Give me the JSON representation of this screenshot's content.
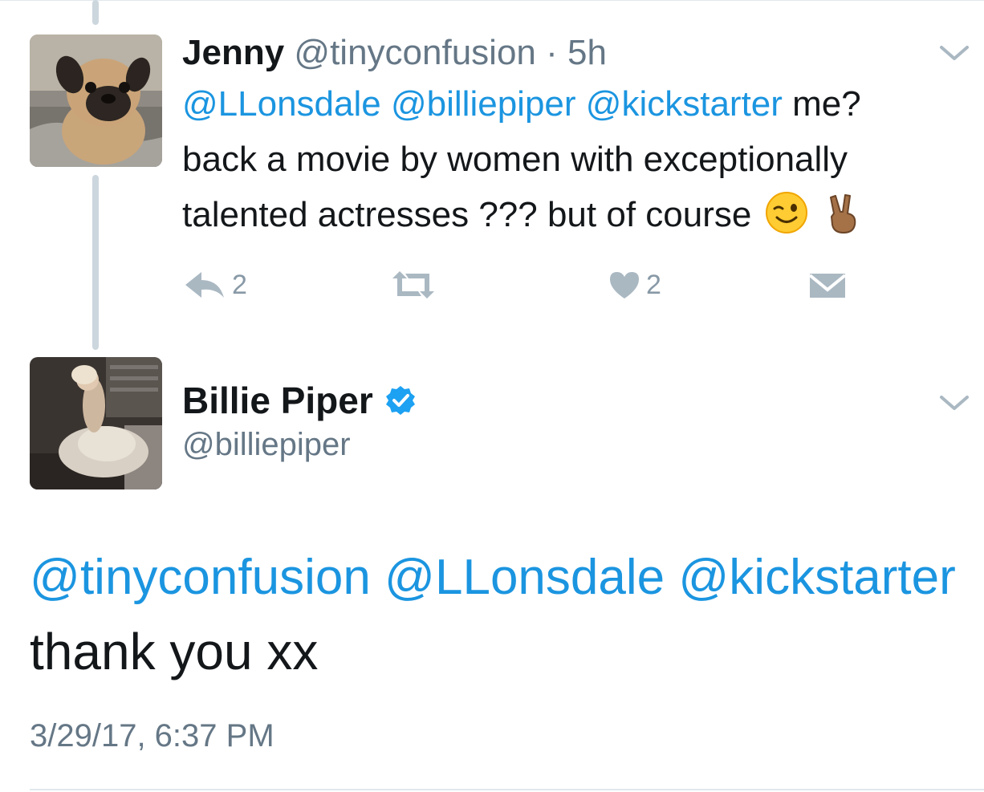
{
  "parent_tweet": {
    "author_name": "Jenny",
    "author_handle": "@tinyconfusion",
    "separator": "·",
    "time_ago": "5h",
    "mentions": [
      "@LLonsdale",
      "@billiepiper",
      "@kickstarter"
    ],
    "text_after_mentions": "me?",
    "text_line2": "back a movie by women with exceptionally",
    "text_line3": "talented actresses ??? but of course",
    "emojis": [
      "winking-face-emoji",
      "victory-hand-emoji"
    ],
    "reply_count": "2",
    "like_count": "2",
    "icons": {
      "reply": "reply-icon",
      "retweet": "retweet-icon",
      "like": "heart-icon",
      "dm": "envelope-icon",
      "menu": "chevron-down-icon"
    }
  },
  "reply_tweet": {
    "author_name": "Billie Piper",
    "author_handle": "@billiepiper",
    "verified": true,
    "mentions_text": "@tinyconfusion @LLonsdale @kickstarter",
    "body": "thank you xx",
    "timestamp": "3/29/17, 6:37 PM"
  },
  "colors": {
    "link": "#1b95e0",
    "text": "#14171a",
    "secondary": "#657786",
    "icon": "#8899a6",
    "thread_line": "#ccd6dd",
    "verified": "#1da1f2"
  }
}
